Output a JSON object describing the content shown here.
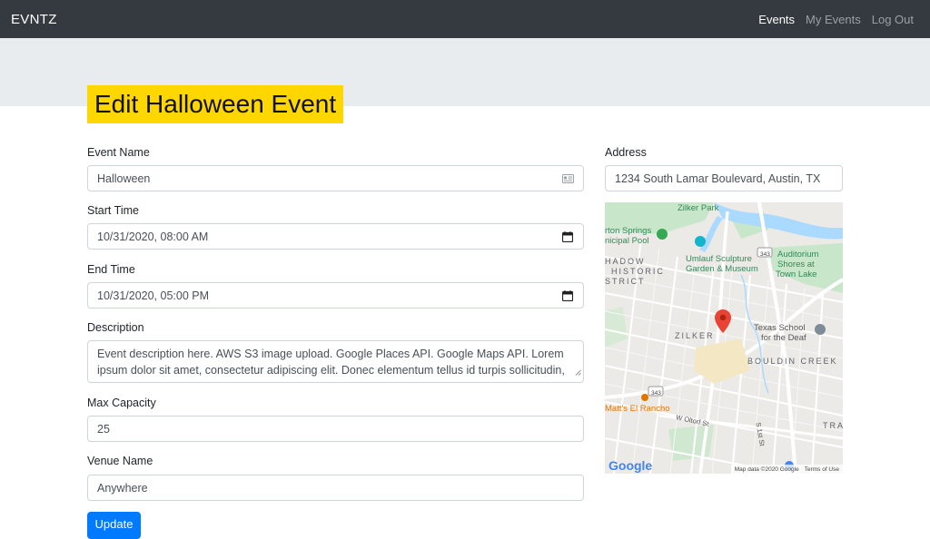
{
  "nav": {
    "brand": "EVNTZ",
    "links": [
      "Events",
      "My Events",
      "Log Out"
    ]
  },
  "page": {
    "title": "Edit Halloween Event"
  },
  "form": {
    "event_name_label": "Event Name",
    "event_name_value": "Halloween",
    "start_time_label": "Start Time",
    "start_time_value": "10/31/2020, 08:00 AM",
    "end_time_label": "End Time",
    "end_time_value": "10/31/2020, 05:00 PM",
    "description_label": "Description",
    "description_line1": "Event description here. AWS S3 image upload. Google Places API. Google Maps API. Lorem",
    "description_line2": "ipsum dolor sit amet, consectetur adipiscing elit. Donec elementum tellus id turpis sollicitudin,",
    "max_capacity_label": "Max Capacity",
    "max_capacity_value": "25",
    "venue_name_label": "Venue Name",
    "venue_name_value": "Anywhere",
    "address_label": "Address",
    "address_value": "1234 South Lamar Boulevard, Austin, TX",
    "submit_label": "Update"
  },
  "map": {
    "labels": {
      "zilker_park": "Zilker Park",
      "springs_1": "rton Springs",
      "springs_2": "nicipal Pool",
      "umlauf_1": "Umlauf Sculpture",
      "umlauf_2": "Garden & Museum",
      "auditorium_1": "Auditorium",
      "auditorium_2": "Shores at",
      "auditorium_3": "Town Lake",
      "hist_1": "HADOW",
      "hist_2": "HISTORIC",
      "hist_3": "STRICT",
      "zilker": "ZILKER",
      "texas_school_1": "Texas School",
      "texas_school_2": "for the Deaf",
      "bouldin": "BOULDIN CREEK",
      "mattes": "Matt's El Rancho",
      "oltorf": "W Oltorf St",
      "first_st": "S 1st St",
      "tra": "TRA",
      "hwy": "343",
      "google": "Google",
      "map_data": "Map data ©2020 Google",
      "terms": "Terms of Use"
    },
    "marker_color": "#ea4335",
    "water_color": "#aadaff",
    "park_color": "#c8e6c9"
  },
  "colors": {
    "navbar": "#343a40",
    "jumbotron": "#e9ecef",
    "title_highlight": "#ffd700",
    "primary": "#007bff"
  }
}
